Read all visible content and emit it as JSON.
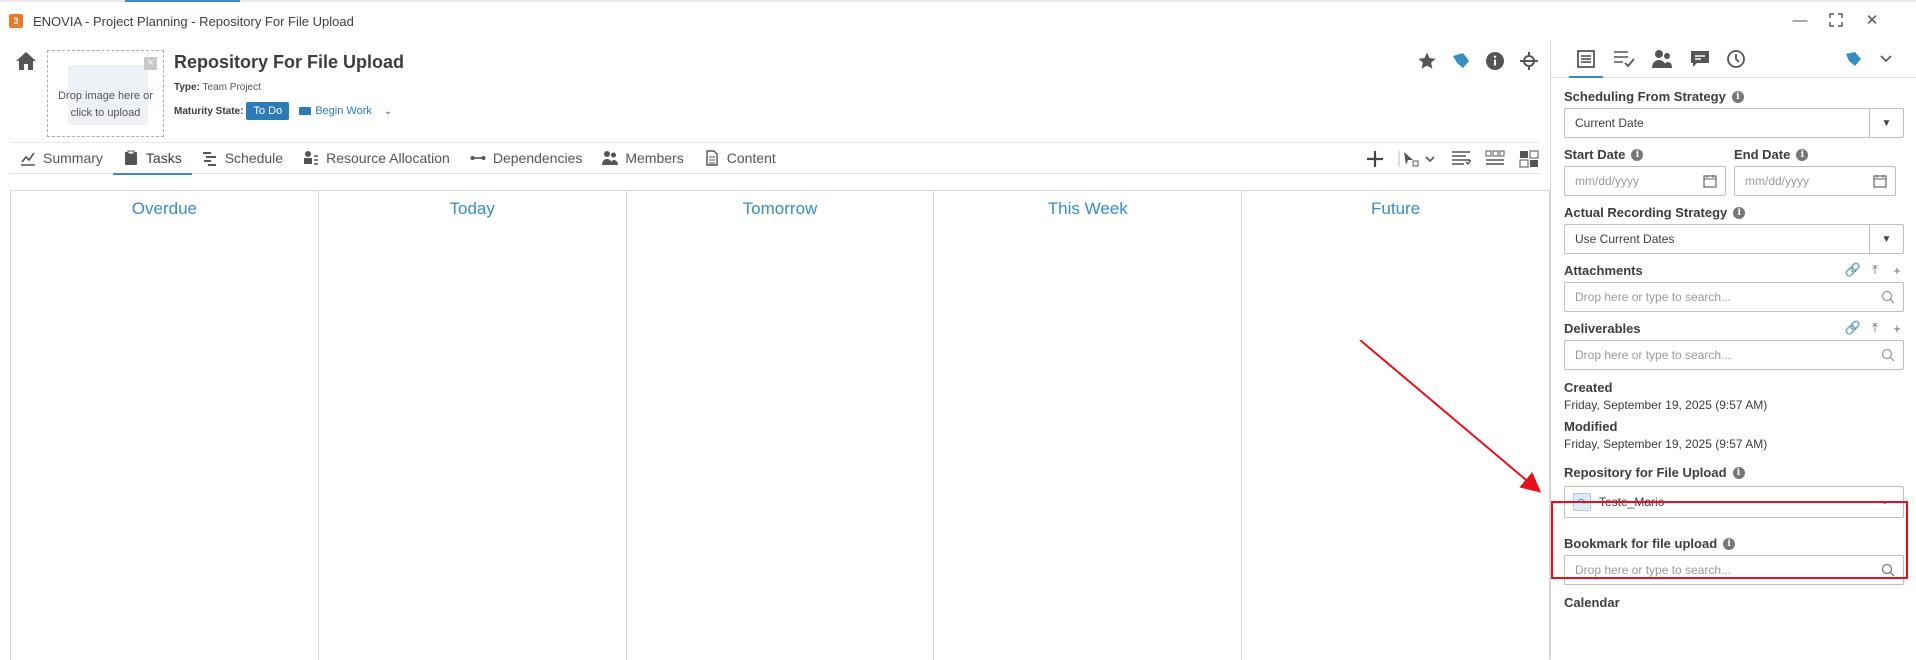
{
  "window": {
    "title": "ENOVIA - Project Planning - Repository For File Upload",
    "controls": [
      "minimize",
      "maximize",
      "close"
    ]
  },
  "header": {
    "drop_image_text": "Drop image here or click to upload",
    "object_title": "Repository For File Upload",
    "type_label": "Type:",
    "type_value": "Team Project",
    "maturity_label": "Maturity State:",
    "maturity_value": "To Do",
    "begin_work": "Begin Work",
    "actions": [
      "star-icon",
      "bookmark-icon",
      "info-icon",
      "settings-icon"
    ]
  },
  "tabs": [
    {
      "label": "Summary",
      "icon": "chart-icon",
      "active": false
    },
    {
      "label": "Tasks",
      "icon": "clipboard-icon",
      "active": true
    },
    {
      "label": "Schedule",
      "icon": "gantt-icon",
      "active": false
    },
    {
      "label": "Resource Allocation",
      "icon": "resource-icon",
      "active": false
    },
    {
      "label": "Dependencies",
      "icon": "dependency-icon",
      "active": false
    },
    {
      "label": "Members",
      "icon": "members-icon",
      "active": false
    },
    {
      "label": "Content",
      "icon": "document-icon",
      "active": false
    }
  ],
  "board": {
    "columns": [
      "Overdue",
      "Today",
      "Tomorrow",
      "This Week",
      "Future"
    ]
  },
  "panel": {
    "scheduling_label": "Scheduling From Strategy",
    "scheduling_value": "Current Date",
    "start_date_label": "Start Date",
    "start_date_placeholder": "mm/dd/yyyy",
    "end_date_label": "End Date",
    "end_date_placeholder": "mm/dd/yyyy",
    "actual_recording_label": "Actual Recording Strategy",
    "actual_recording_value": "Use Current Dates",
    "attachments_label": "Attachments",
    "attachments_placeholder": "Drop here or type to search...",
    "deliverables_label": "Deliverables",
    "deliverables_placeholder": "Drop here or type to search...",
    "created_label": "Created",
    "created_value": "Friday, September 19, 2025 (9:57 AM)",
    "modified_label": "Modified",
    "modified_value": "Friday, September 19, 2025 (9:57 AM)",
    "repo_label": "Repository for File Upload",
    "repo_value": "Teste_Mario",
    "bookmark_label": "Bookmark for file upload",
    "bookmark_placeholder": "Drop here or type to search...",
    "calendar_label": "Calendar"
  },
  "colors": {
    "accent": "#368ec4",
    "badge": "#2b7bb9",
    "highlight": "#e8101a",
    "app_logo": "#e87a2a"
  }
}
